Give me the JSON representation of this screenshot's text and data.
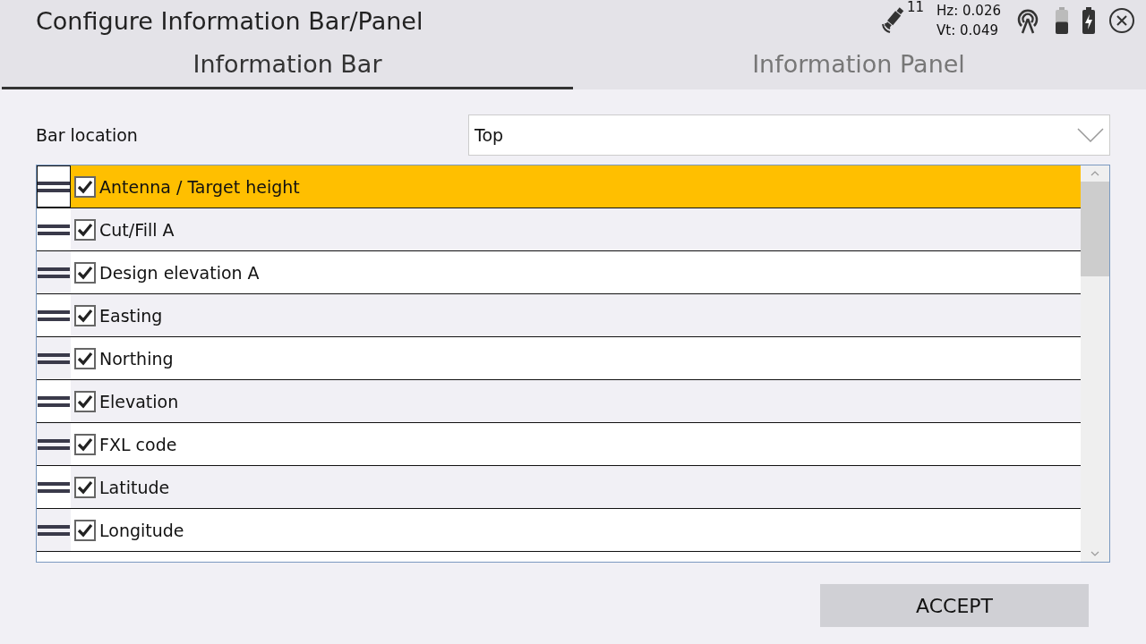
{
  "window": {
    "title": "Configure Information Bar/Panel"
  },
  "status": {
    "satellites": "11",
    "hz": "Hz: 0.026",
    "vt": "Vt: 0.049",
    "battery": {
      "level": 0.5
    }
  },
  "tabs": [
    {
      "label": "Information Bar",
      "selected": true
    },
    {
      "label": "Information Panel",
      "selected": false
    }
  ],
  "bar_location": {
    "label": "Bar location",
    "value": "Top"
  },
  "items": [
    {
      "label": "Antenna / Target height",
      "checked": true,
      "selected": true
    },
    {
      "label": "Cut/Fill A",
      "checked": true,
      "selected": false
    },
    {
      "label": "Design elevation A",
      "checked": true,
      "selected": false
    },
    {
      "label": "Easting",
      "checked": true,
      "selected": false
    },
    {
      "label": "Northing",
      "checked": true,
      "selected": false
    },
    {
      "label": "Elevation",
      "checked": true,
      "selected": false
    },
    {
      "label": "FXL code",
      "checked": true,
      "selected": false
    },
    {
      "label": "Latitude",
      "checked": true,
      "selected": false
    },
    {
      "label": "Longitude",
      "checked": true,
      "selected": false
    }
  ],
  "buttons": [
    "ACCEPT"
  ]
}
